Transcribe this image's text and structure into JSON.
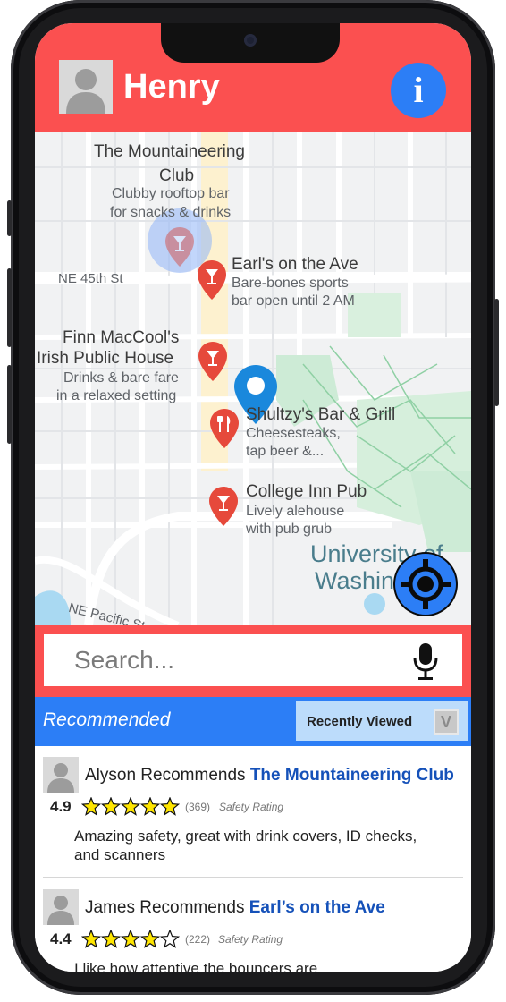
{
  "header": {
    "user_name": "Henry",
    "info_label": "i"
  },
  "map": {
    "places": [
      {
        "name": "The Mountaineering",
        "name2": "Club",
        "desc": "Clubby rooftop bar",
        "desc2": "for snacks & drinks"
      },
      {
        "name": "Earl's on the Ave",
        "desc": "Bare-bones sports",
        "desc2": "bar open until 2 AM"
      },
      {
        "name": "Finn MacCool's",
        "name2": "Irish Public House",
        "desc": "Drinks & bare fare",
        "desc2": "in a relaxed setting"
      },
      {
        "name": "Shultzy's Bar & Grill",
        "desc": "Cheesesteaks,",
        "desc2": "tap beer &..."
      },
      {
        "name": "College Inn Pub",
        "desc": "Lively alehouse",
        "desc2": "with pub grub"
      }
    ],
    "streets": {
      "ne45": "NE 45th St",
      "pacific": "NE Pacific St"
    },
    "area_label": "University of",
    "area_label2": "Washin"
  },
  "search": {
    "placeholder": "Search..."
  },
  "tabs": {
    "recommended": "Recommended",
    "recently_viewed": "Recently Viewed",
    "toggle": "V"
  },
  "recommendations": [
    {
      "recommender": "Alyson Recommends",
      "place": "The Mountaineering Club",
      "rating": "4.9",
      "stars": 5,
      "count": "(369)",
      "safety_label": "Safety Rating",
      "review": "Amazing safety, great with drink covers, ID checks, and scanners"
    },
    {
      "recommender": "James Recommends",
      "place": "Earl’s on the Ave",
      "rating": "4.4",
      "stars": 4.5,
      "count": "(222)",
      "safety_label": "Safety Rating",
      "review": "I like how attentive the bouncers are"
    }
  ],
  "colors": {
    "brand_red": "#fb5050",
    "accent_blue": "#2c7ef6",
    "place_blue": "#1551b9",
    "star": "#ffe600"
  }
}
